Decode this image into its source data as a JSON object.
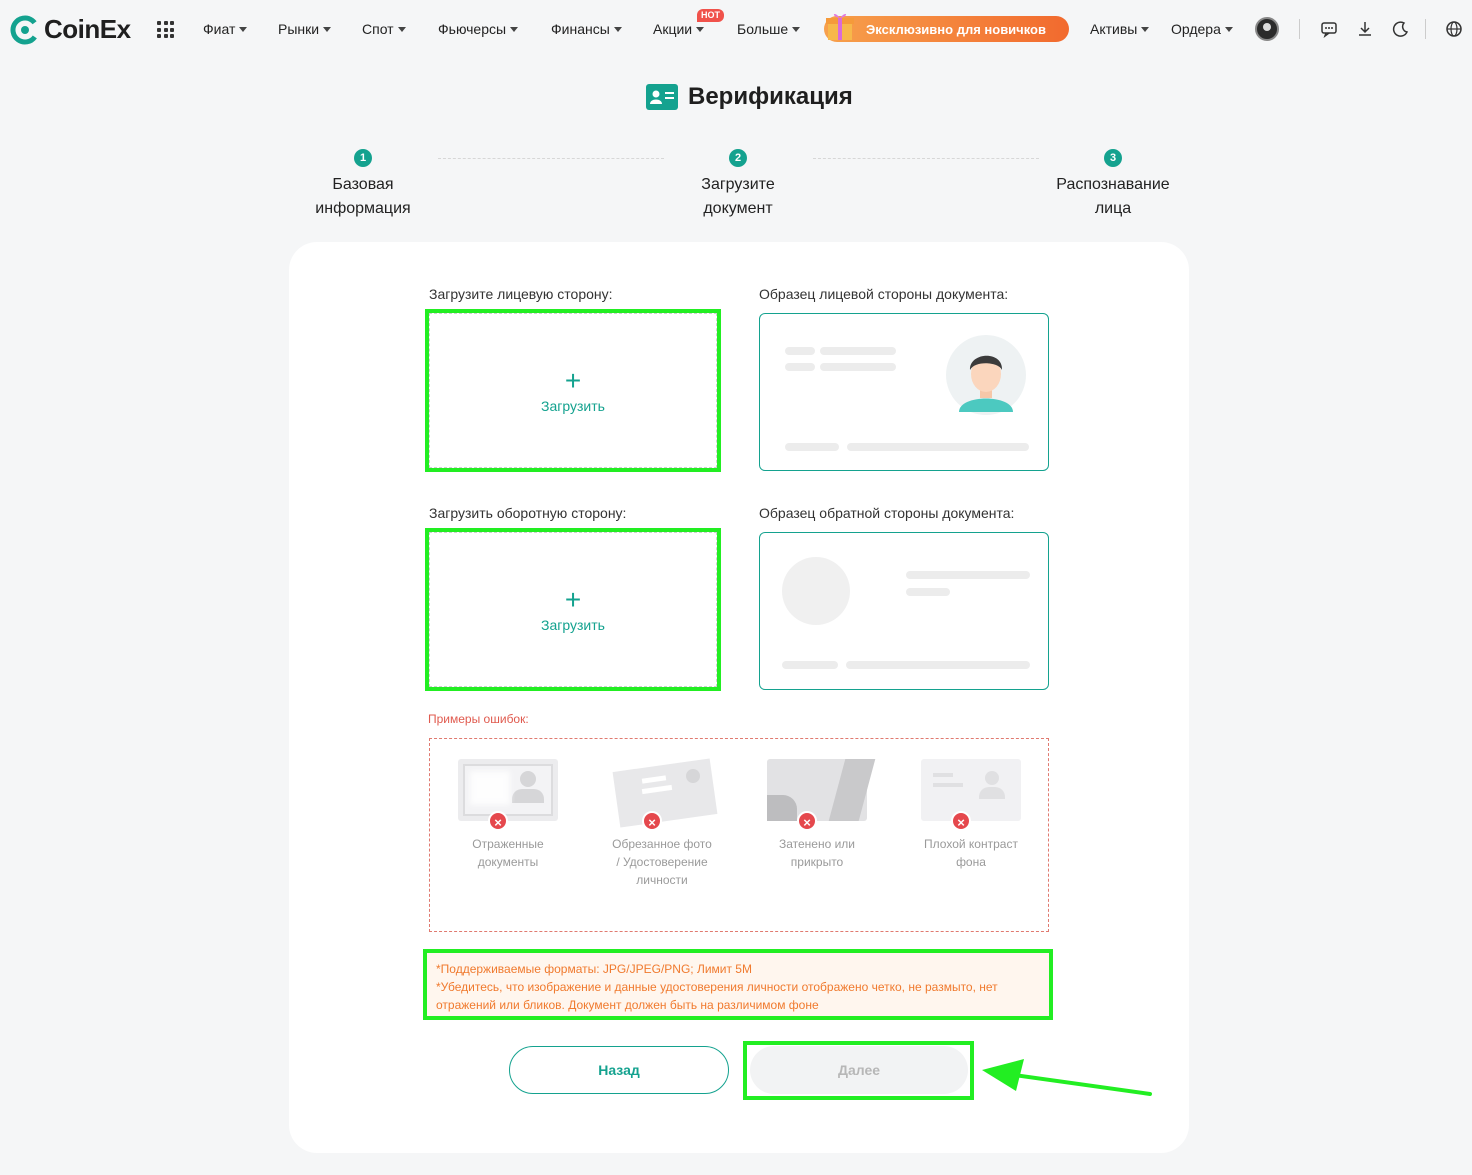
{
  "header": {
    "logo_text": "CoinEx",
    "nav": [
      {
        "label": "Фиат"
      },
      {
        "label": "Рынки"
      },
      {
        "label": "Спот"
      },
      {
        "label": "Фьючерсы"
      },
      {
        "label": "Финансы"
      },
      {
        "label": "Акции"
      },
      {
        "label": "Больше"
      }
    ],
    "hot_badge": "HOT",
    "promo_label": "Эксклюзивно для новичков",
    "assets_label": "Активы",
    "orders_label": "Ордера",
    "icons": [
      "apps-grid-icon",
      "avatar",
      "chat-icon",
      "download-icon",
      "moon-icon",
      "globe-icon"
    ]
  },
  "page": {
    "title": "Верификация"
  },
  "steps": [
    {
      "num": "1",
      "line1": "Базовая",
      "line2": "информация"
    },
    {
      "num": "2",
      "line1": "Загрузите",
      "line2": "документ"
    },
    {
      "num": "3",
      "line1": "Распознавание",
      "line2": "лица"
    }
  ],
  "upload": {
    "front_label": "Загрузите лицевую сторону:",
    "back_label": "Загрузить оборотную сторону:",
    "front_sample_label": "Образец лицевой стороны документа:",
    "back_sample_label": "Образец обратной стороны документа:",
    "button_text": "Загрузить",
    "plus": "+"
  },
  "errors": {
    "label": "Примеры ошибок:",
    "items": [
      {
        "text": "Отраженные документы"
      },
      {
        "text": "Обрезанное фото / Удостоверение личности"
      },
      {
        "text": "Затенено или прикрыто"
      },
      {
        "text": "Плохой контраст фона"
      }
    ]
  },
  "notice": {
    "line1": "*Поддерживаемые форматы: JPG/JPEG/PNG; Лимит 5M",
    "line2": "*Убедитесь, что изображение и данные удостоверения личности отображено четко, не размыто, нет отражений или бликов. Документ должен быть на различимом фоне"
  },
  "buttons": {
    "back": "Назад",
    "next": "Далее"
  },
  "colors": {
    "accent": "#14a28f",
    "highlight": "#22ee22",
    "error": "#e5484d",
    "notice_text": "#f07a2e"
  }
}
